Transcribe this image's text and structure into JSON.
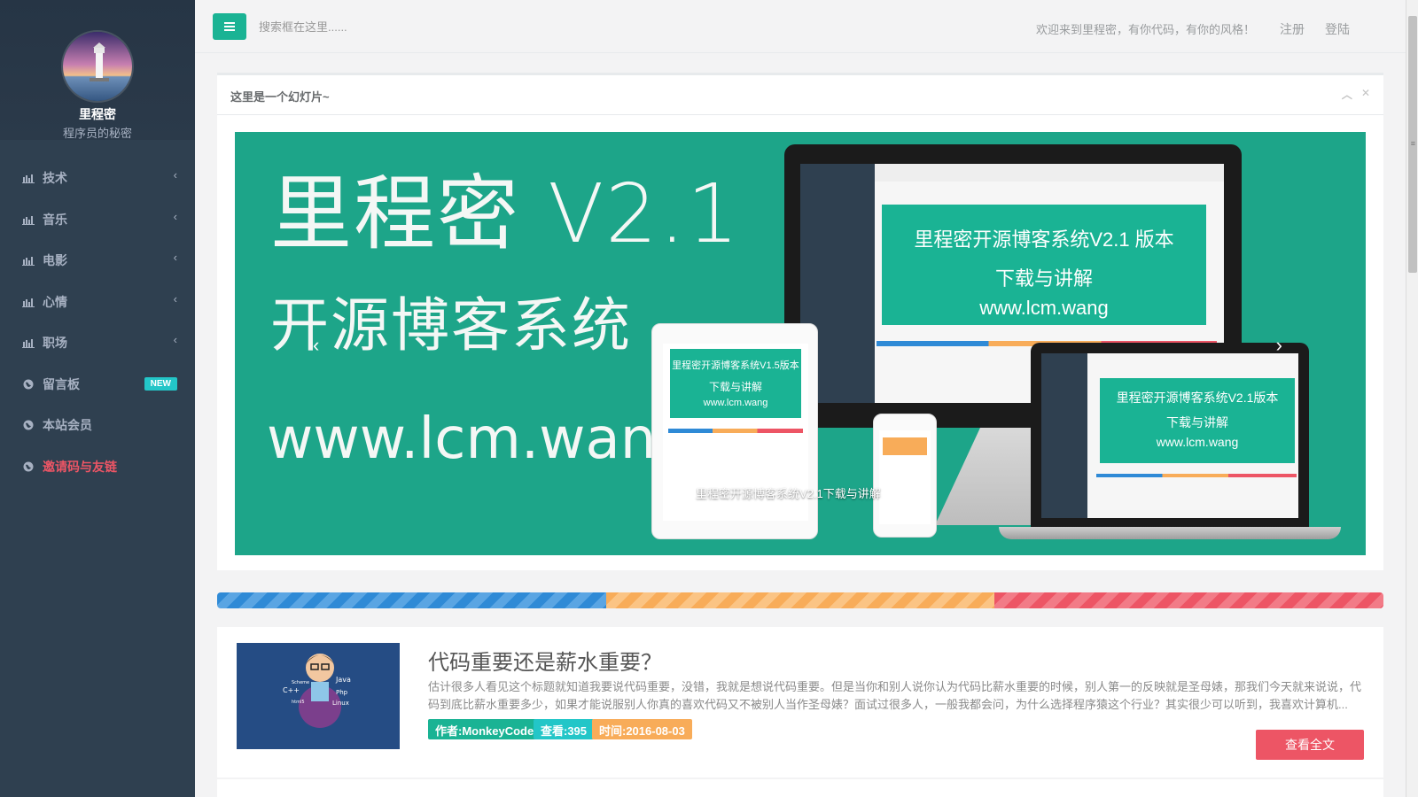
{
  "colors": {
    "sidebar_bg": "#2f4050",
    "accent_green": "#1ab394",
    "accent_red": "#ed5565",
    "badge_cyan": "#23c6c8"
  },
  "profile": {
    "name": "里程密",
    "subtitle": "程序员的秘密"
  },
  "sidebar": {
    "items": [
      {
        "label": "技术",
        "icon": "bar-chart-icon",
        "has_chevron": true
      },
      {
        "label": "音乐",
        "icon": "bar-chart-icon",
        "has_chevron": true
      },
      {
        "label": "电影",
        "icon": "bar-chart-icon",
        "has_chevron": true
      },
      {
        "label": "心情",
        "icon": "bar-chart-icon",
        "has_chevron": true
      },
      {
        "label": "职场",
        "icon": "bar-chart-icon",
        "has_chevron": true
      },
      {
        "label": "留言板",
        "icon": "globe-icon",
        "badge": "NEW"
      },
      {
        "label": "本站会员",
        "icon": "globe-icon"
      },
      {
        "label": "邀请码与友链",
        "icon": "globe-icon",
        "accent": true
      }
    ]
  },
  "topbar": {
    "search_placeholder": "搜索框在这里......",
    "welcome": "欢迎来到里程密，有你代码，有你的风格！",
    "register": "注册",
    "login": "登陆"
  },
  "slider_box": {
    "title": "这里是一个幻灯片~",
    "slide": {
      "headline": "里程密 V2.1",
      "subheadline": "开源博客系统",
      "url": "www.lcm.wang",
      "caption": "里程密开源博客系统V2.1下载与讲解",
      "monitor_text": [
        "里程密开源博客系统V2.1 版本",
        "下载与讲解",
        "www.lcm.wang"
      ],
      "tablet_text": [
        "里程密开源博客系统V1.5版本",
        "下载与讲解",
        "www.lcm.wang"
      ],
      "laptop_text": [
        "里程密开源博客系统V2.1版本",
        "下载与讲解",
        "www.lcm.wang"
      ]
    }
  },
  "article": {
    "title": "代码重要还是薪水重要？",
    "excerpt": "估计很多人看见这个标题就知道我要说代码重要，没错，我就是想说代码重要。但是当你和别人说你认为代码比薪水重要的时候，别人第一的反映就是圣母婊，那我们今天就来说说，代码到底比薪水重要多少，如果才能说服别人你真的喜欢代码又不被别人当作圣母婊？面试过很多人，一般我都会问，为什么选择程序猿这个行业？其实很少可以听到，我喜欢计算机...",
    "author_tag": "作者:MonkeyCode",
    "views_tag": "查看:395",
    "time_tag": "时间:2016-08-03",
    "read_more": "查看全文",
    "thumb_words": [
      "Java",
      "Php",
      "C++",
      "Linux",
      "Scheme",
      "html5"
    ]
  }
}
